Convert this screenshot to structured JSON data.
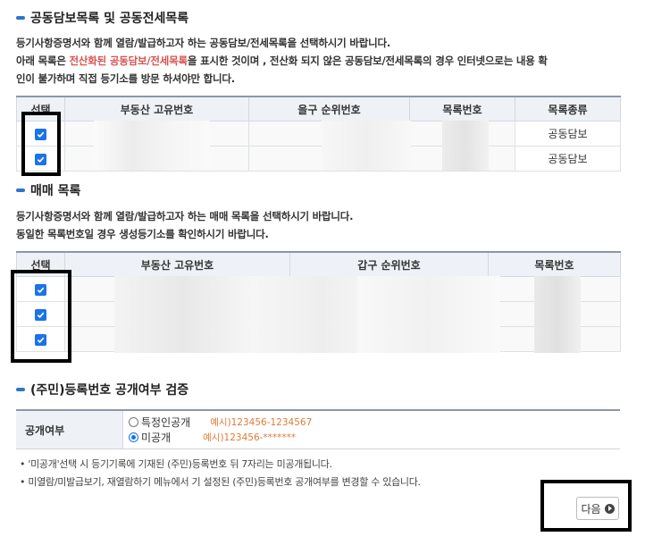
{
  "section1": {
    "title": "공동담보목록 및 공동전세목록",
    "desc1": "등기사항증명서와 함께 열람/발급하고자 하는 공동담보/전세목록을 선택하시기 바랍니다.",
    "desc2_pre": "아래 목록은 ",
    "desc2_red": "전산화된 공동담보/전세목록",
    "desc2_post": "을 표시한 것이며 , 전산화 되지 않은 공동담보/전세목록의 경우 인터넷으로는 내용 확",
    "desc3": "인이 불가하며 직접 등기소를 방문 하셔야만 합니다.",
    "columns": [
      "선택",
      "부동산 고유번호",
      "을구 순위번호",
      "목록번호",
      "목록종류"
    ],
    "rows": [
      {
        "checked": true,
        "kind": "공동담보"
      },
      {
        "checked": true,
        "kind": "공동담보"
      }
    ]
  },
  "section2": {
    "title": "매매 목록",
    "desc1": "등기사항증명서와 함께 열람/발급하고자 하는 매매 목록을 선택하시기 바랍니다.",
    "desc2": "동일한 목록번호일 경우 생성등기소를 확인하시기 바랍니다.",
    "columns": [
      "선택",
      "부동산 고유번호",
      "갑구 순위번호",
      "목록번호"
    ],
    "rows": [
      {
        "checked": true
      },
      {
        "checked": true
      },
      {
        "checked": true
      }
    ]
  },
  "section3": {
    "title": "(주민)등록번호 공개여부 검증",
    "label": "공개여부",
    "options": [
      {
        "label": "특정인공개",
        "example": "예시)123456-1234567",
        "selected": false
      },
      {
        "label": "미공개",
        "example": "예시)123456-*******",
        "selected": true
      }
    ],
    "notes": [
      "'미공개'선택 시 등기기록에 기재된 (주민)등록번호 뒤 7자리는 미공개됩니다.",
      "미열람/미발급보기, 재열람하기 메뉴에서 기 설정된 (주민)등록번호 공개여부를 변경할 수 있습니다."
    ]
  },
  "next_button": {
    "label": "다음"
  },
  "colors": {
    "accent": "#2e75c9",
    "checkbox": "#1a73e8",
    "red": "#d9534f",
    "example": "#e07b39"
  }
}
